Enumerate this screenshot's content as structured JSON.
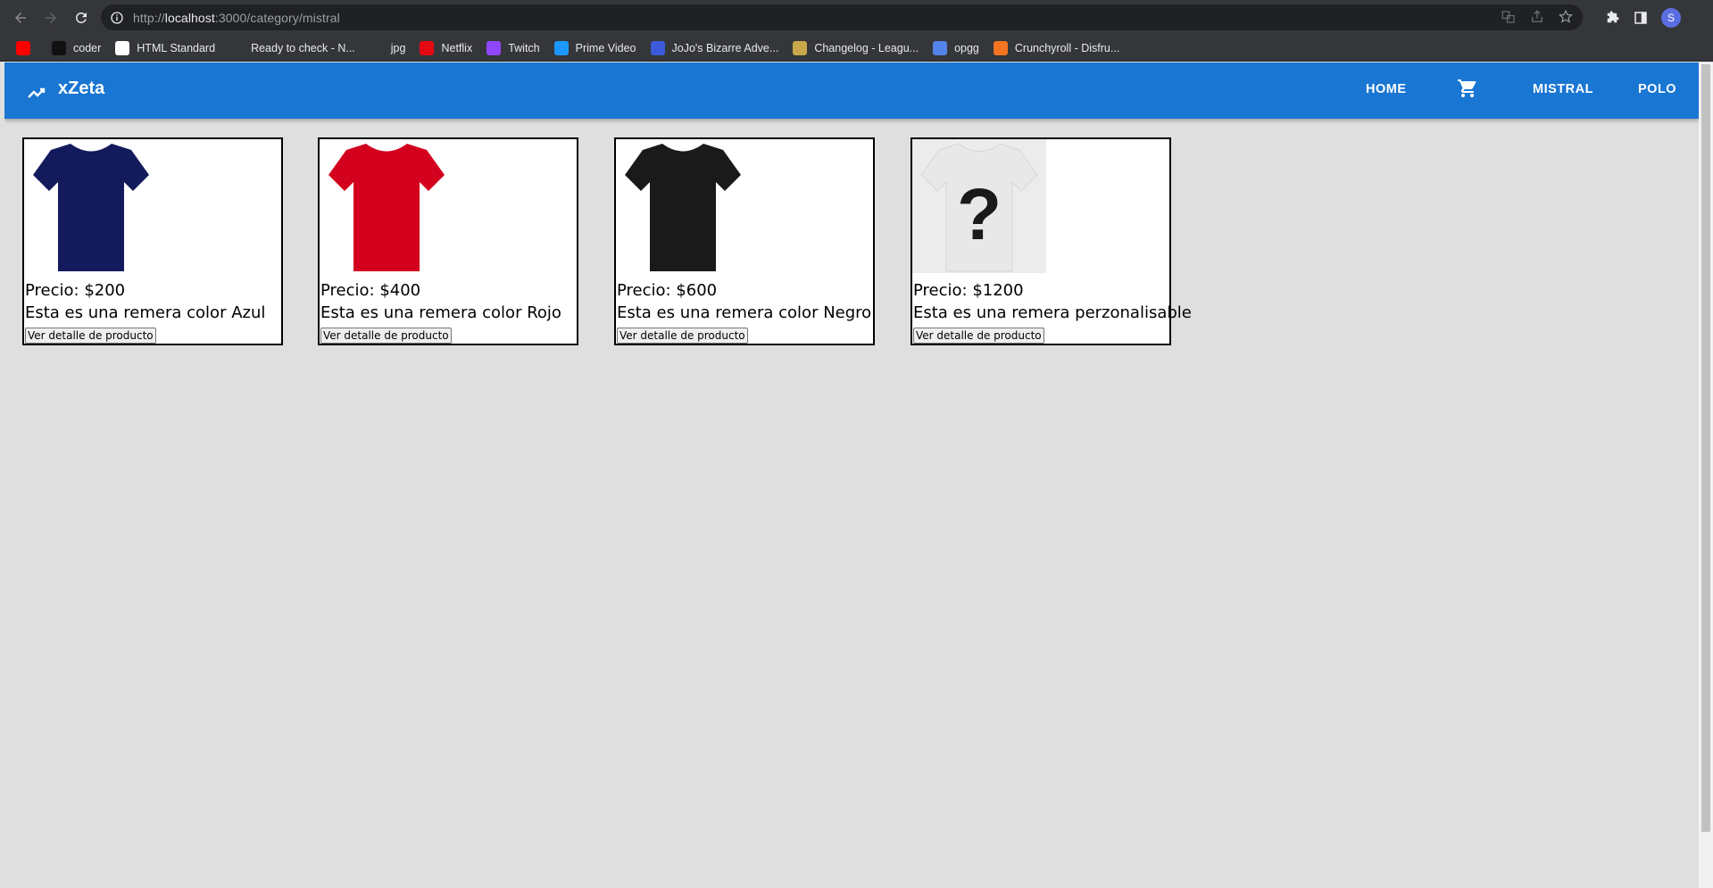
{
  "browser": {
    "url_scheme": "http://",
    "url_host": "localhost",
    "url_path": ":3000/category/mistral",
    "profile_initial": "S",
    "bookmarks": [
      {
        "label": "",
        "icon": "youtube-icon",
        "color": "#ff0000"
      },
      {
        "label": "coder",
        "icon": "coder-icon",
        "color": "#111111"
      },
      {
        "label": "HTML Standard",
        "icon": "html-standard-icon",
        "color": "#ffffff"
      },
      {
        "label": "Ready to check - N...",
        "icon": "nu-icon",
        "color": "#35363a"
      },
      {
        "label": "jpg",
        "icon": "f-icon",
        "color": "#35363a"
      },
      {
        "label": "Netflix",
        "icon": "netflix-icon",
        "color": "#e50914"
      },
      {
        "label": "Twitch",
        "icon": "twitch-icon",
        "color": "#9146ff"
      },
      {
        "label": "Prime Video",
        "icon": "prime-video-icon",
        "color": "#1a98ff"
      },
      {
        "label": "JoJo's Bizarre Adve...",
        "icon": "jojo-icon",
        "color": "#3b5bdb"
      },
      {
        "label": "Changelog - Leagu...",
        "icon": "changelog-icon",
        "color": "#c8a84b"
      },
      {
        "label": "opgg",
        "icon": "opgg-icon",
        "color": "#5383e8"
      },
      {
        "label": "Crunchyroll - Disfru...",
        "icon": "crunchyroll-icon",
        "color": "#f47521"
      }
    ]
  },
  "app": {
    "brand": "xZeta",
    "nav": {
      "home": "HOME",
      "mistral": "MISTRAL",
      "polo": "POLO"
    },
    "accent": "#1976d2"
  },
  "products": [
    {
      "price": "Precio: $200",
      "description": "Esta es una remera color Azul",
      "button": "Ver detalle de producto",
      "shirt_color": "#131b5c",
      "image": "blue-tshirt"
    },
    {
      "price": "Precio: $400",
      "description": "Esta es una remera color Rojo",
      "button": "Ver detalle de producto",
      "shirt_color": "#d3001e",
      "image": "red-tshirt"
    },
    {
      "price": "Precio: $600",
      "description": "Esta es una remera color Negro",
      "button": "Ver detalle de producto",
      "shirt_color": "#1a1a1a",
      "image": "black-tshirt"
    },
    {
      "price": "Precio: $1200",
      "description": "Esta es una remera perzonalisable",
      "button": "Ver detalle de producto",
      "shirt_color": "#e8e8e8",
      "image": "question-mark-tshirt"
    }
  ]
}
